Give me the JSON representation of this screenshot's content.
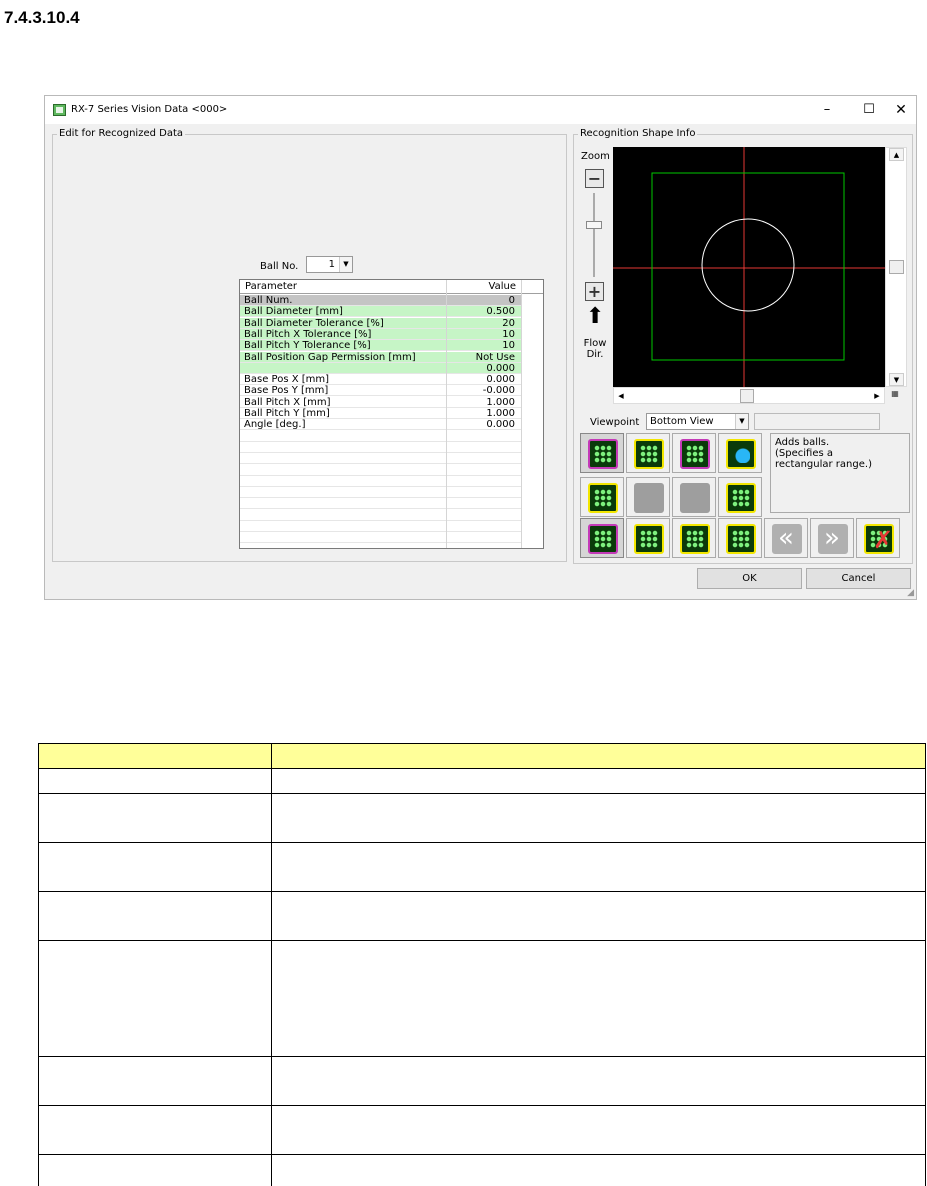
{
  "page": {
    "heading": "7.4.3.10.4"
  },
  "window": {
    "title": "RX-7 Series Vision Data <000>",
    "minimize_glyph": "–",
    "maximize_glyph": "☐",
    "close_glyph": "✕"
  },
  "left_panel": {
    "title": "Edit for Recognized Data",
    "ball_no_label": "Ball No.",
    "ball_no_value": "1",
    "grid": {
      "headers": [
        "Parameter",
        "Value"
      ],
      "rows": [
        {
          "parameter": "Ball Num.",
          "value": "0",
          "highlight": "gray"
        },
        {
          "parameter": "Ball Diameter [mm]",
          "value": "0.500",
          "highlight": "green"
        },
        {
          "parameter": "Ball Diameter Tolerance [%]",
          "value": "20",
          "highlight": "green"
        },
        {
          "parameter": "Ball Pitch X Tolerance [%]",
          "value": "10",
          "highlight": "green"
        },
        {
          "parameter": "Ball Pitch Y Tolerance [%]",
          "value": "10",
          "highlight": "green"
        },
        {
          "parameter": "Ball Position Gap Permission [mm]",
          "value": "Not Use",
          "highlight": "green"
        },
        {
          "parameter": "",
          "value": "0.000",
          "highlight": "green"
        },
        {
          "parameter": "Base Pos X [mm]",
          "value": "0.000",
          "highlight": "none"
        },
        {
          "parameter": "Base Pos Y [mm]",
          "value": "-0.000",
          "highlight": "none"
        },
        {
          "parameter": "Ball Pitch X [mm]",
          "value": "1.000",
          "highlight": "none"
        },
        {
          "parameter": "Ball Pitch Y [mm]",
          "value": "1.000",
          "highlight": "none"
        },
        {
          "parameter": "Angle [deg.]",
          "value": "0.000",
          "highlight": "none"
        }
      ]
    }
  },
  "right_panel": {
    "title": "Recognition Shape Info",
    "zoom_label": "Zoom",
    "zoom_minus": "−",
    "zoom_plus": "+",
    "flow_arrow": "⬆",
    "flow_label_1": "Flow",
    "flow_label_2": "Dir.",
    "viewpoint_label": "Viewpoint",
    "viewpoint_value": "Bottom View",
    "help_text": [
      "Adds balls.",
      "(Specifies a",
      "rectangular range.)"
    ],
    "colors": {
      "viewport_bg": "#000000",
      "crosshair": "#e53935",
      "range_rect": "#00c800",
      "ball_outline": "#ffffff"
    },
    "tools": [
      {
        "name": "add-balls-rect-tool",
        "icon": "add-balls-rect-icon",
        "style": "mag",
        "pressed": true
      },
      {
        "name": "delete-balls-tool",
        "icon": "delete-balls-icon",
        "style": "",
        "pressed": false
      },
      {
        "name": "move-balls-tool",
        "icon": "move-balls-icon",
        "style": "mag",
        "pressed": false
      },
      {
        "name": "globe-tool",
        "icon": "globe-icon",
        "style": "globe",
        "pressed": false
      },
      {
        "name": "grid-balls-tool",
        "icon": "grid-balls-icon",
        "style": "",
        "pressed": false
      },
      {
        "name": "disabled-tool-1",
        "icon": "blank-icon",
        "style": "grey",
        "pressed": false
      },
      {
        "name": "disabled-tool-2",
        "icon": "blank-icon",
        "style": "grey",
        "pressed": false
      },
      {
        "name": "rotate-balls-tool",
        "icon": "rotate-balls-icon",
        "style": "",
        "pressed": false
      },
      {
        "name": "select-all-tool",
        "icon": "select-all-icon",
        "style": "mag",
        "pressed": true
      },
      {
        "name": "select-range-tool",
        "icon": "select-range-icon",
        "style": "",
        "pressed": false
      },
      {
        "name": "select-inner-tool",
        "icon": "select-inner-icon",
        "style": "",
        "pressed": false
      },
      {
        "name": "select-outer-tool",
        "icon": "select-outer-icon",
        "style": "",
        "pressed": false
      },
      {
        "name": "prev-button",
        "icon": "rewind-icon",
        "style": "nav",
        "pressed": false
      },
      {
        "name": "next-button",
        "icon": "fast-forward-icon",
        "style": "nav navr",
        "pressed": false
      },
      {
        "name": "delete-all-tool",
        "icon": "delete-all-icon",
        "style": "del",
        "pressed": false
      }
    ]
  },
  "buttons": {
    "ok": "OK",
    "cancel": "Cancel"
  }
}
